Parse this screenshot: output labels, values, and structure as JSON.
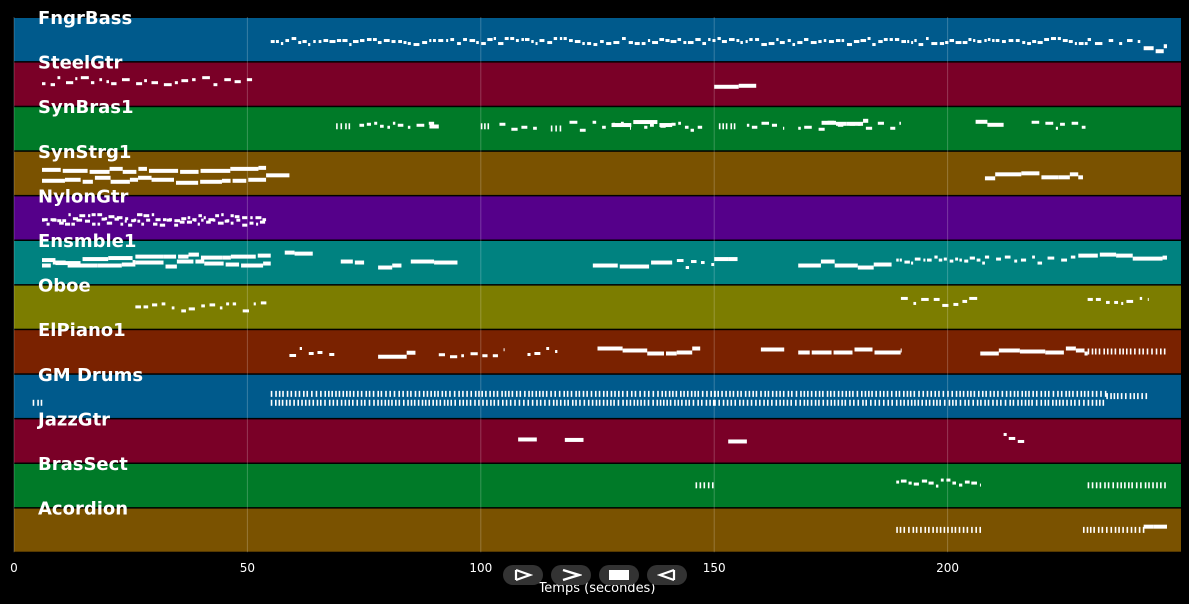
{
  "chart_data": {
    "type": "piano-roll",
    "xlabel": "Temps (secondes)",
    "xlim": [
      0,
      250
    ],
    "x_ticks": [
      0,
      50,
      100,
      150,
      200
    ],
    "grid": true,
    "tracks": [
      {
        "name": "FngrBass",
        "color": "#005a8c",
        "segments": [
          [
            55,
            230,
            0.55,
            "dense"
          ],
          [
            230,
            242,
            0.55,
            "sparse"
          ],
          [
            242,
            247,
            0.7,
            "solid"
          ]
        ]
      },
      {
        "name": "SteelGtr",
        "color": "#7a0027",
        "segments": [
          [
            6,
            51,
            0.45,
            "sparse"
          ],
          [
            150,
            159,
            0.52,
            "solid"
          ]
        ]
      },
      {
        "name": "SynBras1",
        "color": "#007a28",
        "segments": [
          [
            69,
            72,
            0.45,
            "dashed"
          ],
          [
            74,
            90,
            0.45,
            "sparse"
          ],
          [
            89,
            91,
            0.5,
            "solid"
          ],
          [
            100,
            102,
            0.45,
            "dashed"
          ],
          [
            104,
            112,
            0.45,
            "sparse"
          ],
          [
            115,
            117,
            0.5,
            "dashed"
          ],
          [
            119,
            132,
            0.45,
            "sparse"
          ],
          [
            128,
            141,
            0.4,
            "solid"
          ],
          [
            135,
            148,
            0.45,
            "sparse"
          ],
          [
            151,
            155,
            0.45,
            "dashed"
          ],
          [
            157,
            165,
            0.45,
            "sparse"
          ],
          [
            168,
            190,
            0.45,
            "sparse"
          ],
          [
            173,
            183,
            0.35,
            "solid"
          ],
          [
            206,
            212,
            0.35,
            "solid"
          ],
          [
            218,
            230,
            0.45,
            "sparse"
          ]
        ]
      },
      {
        "name": "SynStrg1",
        "color": "#7a5200",
        "segments": [
          [
            6,
            54,
            0.45,
            "solid"
          ],
          [
            6,
            54,
            0.65,
            "solid"
          ],
          [
            54,
            59,
            0.55,
            "solid"
          ],
          [
            208,
            229,
            0.55,
            "solid"
          ]
        ]
      },
      {
        "name": "NylonGtr",
        "color": "#55008a",
        "segments": [
          [
            6,
            54,
            0.5,
            "dense"
          ],
          [
            6,
            54,
            0.6,
            "dense"
          ]
        ]
      },
      {
        "name": "Ensmble1",
        "color": "#008280",
        "segments": [
          [
            6,
            26,
            0.45,
            "solid"
          ],
          [
            6,
            26,
            0.55,
            "solid"
          ],
          [
            26,
            55,
            0.35,
            "solid"
          ],
          [
            26,
            55,
            0.55,
            "solid"
          ],
          [
            58,
            64,
            0.35,
            "solid"
          ],
          [
            70,
            75,
            0.55,
            "solid"
          ],
          [
            78,
            83,
            0.55,
            "solid"
          ],
          [
            85,
            95,
            0.55,
            "solid"
          ],
          [
            124,
            141,
            0.55,
            "solid"
          ],
          [
            142,
            150,
            0.55,
            "sparse"
          ],
          [
            150,
            155,
            0.45,
            "solid"
          ],
          [
            168,
            188,
            0.55,
            "solid"
          ],
          [
            189,
            208,
            0.45,
            "dense"
          ],
          [
            208,
            228,
            0.45,
            "sparse"
          ],
          [
            228,
            247,
            0.35,
            "solid"
          ]
        ]
      },
      {
        "name": "Oboe",
        "color": "#7c7d00",
        "segments": [
          [
            26,
            55,
            0.5,
            "sparse"
          ],
          [
            190,
            207,
            0.4,
            "sparse"
          ],
          [
            230,
            243,
            0.4,
            "sparse"
          ]
        ]
      },
      {
        "name": "ElPiano1",
        "color": "#7a2200",
        "segments": [
          [
            59,
            69,
            0.5,
            "sparse"
          ],
          [
            78,
            86,
            0.55,
            "solid"
          ],
          [
            91,
            105,
            0.55,
            "sparse"
          ],
          [
            110,
            117,
            0.5,
            "sparse"
          ],
          [
            125,
            147,
            0.5,
            "solid"
          ],
          [
            160,
            165,
            0.5,
            "solid"
          ],
          [
            168,
            190,
            0.5,
            "solid"
          ],
          [
            207,
            230,
            0.5,
            "solid"
          ],
          [
            230,
            247,
            0.5,
            "dashed"
          ]
        ]
      },
      {
        "name": "GM Drums",
        "color": "#005a8c",
        "segments": [
          [
            4,
            6,
            0.65,
            "dashed"
          ],
          [
            55,
            150,
            0.45,
            "dashed"
          ],
          [
            55,
            150,
            0.65,
            "dashed"
          ],
          [
            150,
            234,
            0.45,
            "dashed"
          ],
          [
            150,
            234,
            0.65,
            "dashed"
          ],
          [
            234,
            243,
            0.5,
            "dashed"
          ]
        ]
      },
      {
        "name": "JazzGtr",
        "color": "#7a0027",
        "segments": [
          [
            108,
            112,
            0.45,
            "solid"
          ],
          [
            118,
            122,
            0.55,
            "solid"
          ],
          [
            153,
            157,
            0.45,
            "solid"
          ],
          [
            212,
            217,
            0.45,
            "sparse"
          ]
        ]
      },
      {
        "name": "BrasSect",
        "color": "#007a28",
        "segments": [
          [
            146,
            150,
            0.5,
            "dashed"
          ],
          [
            189,
            207,
            0.45,
            "dense"
          ],
          [
            230,
            247,
            0.5,
            "dashed"
          ]
        ]
      },
      {
        "name": "Acordion",
        "color": "#7a5200",
        "segments": [
          [
            189,
            207,
            0.5,
            "dashed"
          ],
          [
            229,
            242,
            0.5,
            "dashed"
          ],
          [
            242,
            247,
            0.45,
            "solid"
          ]
        ]
      }
    ]
  },
  "controls": {
    "play_icon": "play-outline-icon",
    "forward_icon": "forward-chevron-icon",
    "stop_icon": "stop-icon",
    "back_icon": "back-outline-icon"
  }
}
